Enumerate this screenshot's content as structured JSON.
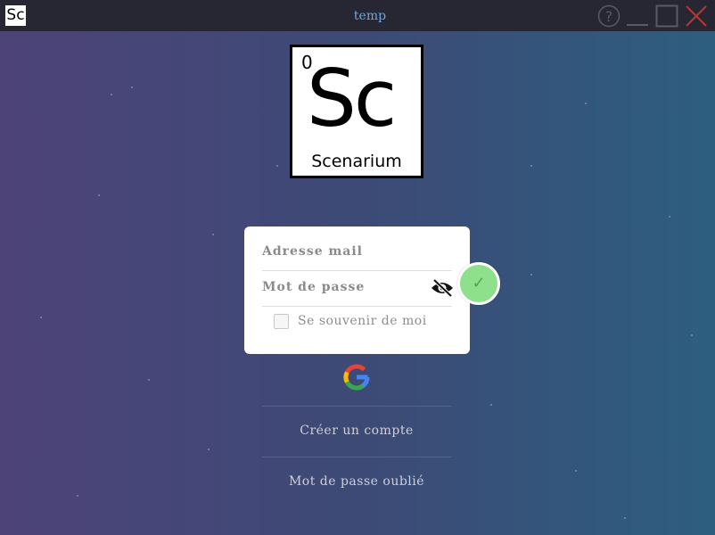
{
  "window": {
    "title": "temp",
    "app_icon_text": "Sc",
    "icons": [
      "help-icon",
      "minimize-icon",
      "maximize-icon",
      "close-icon"
    ]
  },
  "logo": {
    "number": "0",
    "symbol": "Sc",
    "name": "Scenarium"
  },
  "form": {
    "email_placeholder": "Adresse mail",
    "email_value": "",
    "password_placeholder": "Mot de passe",
    "password_value": "",
    "remember_label": "Se souvenir de moi",
    "remember_checked": false,
    "toggle_icon": "eye-slash-icon",
    "submit_icon": "check-icon"
  },
  "links": {
    "google_icon": "google-icon",
    "create_account": "Créer un compte",
    "forgot_password": "Mot de passe oublié"
  },
  "colors": {
    "titlebar": "#272733",
    "title_text": "#6aa9e0",
    "bg_left": "#4d4379",
    "bg_right": "#2d5e80",
    "submit": "#8fe08a",
    "close": "#c0392b"
  }
}
